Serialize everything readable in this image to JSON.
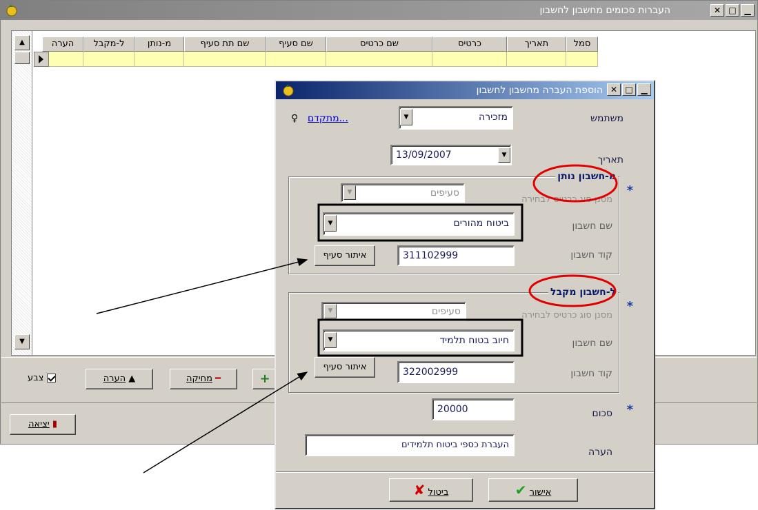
{
  "main_window": {
    "title": "העברות סכומים מחשבון לחשבון",
    "columns": [
      "סמל",
      "תאריך",
      "כרטיס",
      "שם כרטיס",
      "שם סעיף",
      "שם תת סעיף",
      "מ-נותן",
      "ל-מקבל",
      "הערה"
    ],
    "toolbar": {
      "color_checkbox_label": "צבע",
      "color_checked": true,
      "note_button": "הערה",
      "delete_button": "מחיקה",
      "exit_button": "יציאה"
    }
  },
  "dialog": {
    "title": "הוספת העברה מחשבון לחשבון",
    "user_label": "משתמש",
    "user_value": "מזכירה",
    "advanced_link": "מתקדם...",
    "date_label": "תאריך",
    "date_value": "13/09/2007",
    "from_group": {
      "title": "מ-חשבון נותן",
      "filter_label": "מסנן סוג כרטיס לבחירה",
      "filter_value": "סעיפים",
      "account_name_label": "שם חשבון",
      "account_name_value": "ביטוח מהורים",
      "account_code_label": "קוד חשבון",
      "account_code_value": "311102999",
      "locate_button": "איתור סעיף"
    },
    "to_group": {
      "title": "ל-חשבון מקבל",
      "filter_label": "מסנן סוג כרטיס לבחירה",
      "filter_value": "סעיפים",
      "account_name_label": "שם חשבון",
      "account_name_value": "חיוב בטוח תלמיד",
      "account_code_label": "קוד חשבון",
      "account_code_value": "322002999",
      "locate_button": "איתור סעיף"
    },
    "amount_label": "סכום",
    "amount_value": "20000",
    "note_label": "הערה",
    "note_value": "העברת כספי ביטוח תלמידים",
    "ok_button": "אישור",
    "cancel_button": "ביטול",
    "required_marker": "*"
  },
  "colors": {
    "dialog_title_start": "#0a246a",
    "dialog_title_end": "#a6caf0",
    "grid_row": "#ffffb4",
    "annotation_ellipse": "#e00000",
    "annotation_box": "#000000"
  }
}
